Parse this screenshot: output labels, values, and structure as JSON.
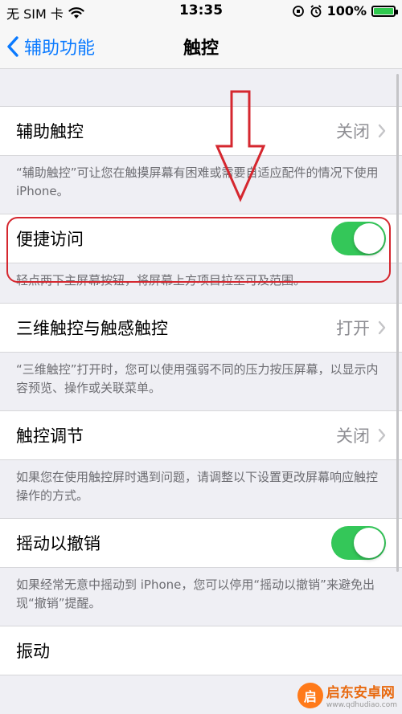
{
  "status_bar": {
    "carrier": "无 SIM 卡",
    "time": "13:35",
    "battery_text": "100%"
  },
  "nav": {
    "back_label": "辅助功能",
    "title": "触控"
  },
  "sections": [
    {
      "label": "辅助触控",
      "value": "关闭",
      "footer": "“辅助触控”可让您在触摸屏幕有困难或需要自适应配件的情况下使用 iPhone。"
    },
    {
      "label": "便捷访问",
      "toggle_on": true,
      "footer": "轻点两下主屏幕按钮，将屏幕上方项目拉至可及范围。"
    },
    {
      "label": "三维触控与触感触控",
      "value": "打开",
      "footer": "“三维触控”打开时，您可以使用强弱不同的压力按压屏幕，以显示内容预览、操作或关联菜单。"
    },
    {
      "label": "触控调节",
      "value": "关闭",
      "footer": "如果您在使用触控屏时遇到问题，请调整以下设置更改屏幕响应触控操作的方式。"
    },
    {
      "label": "摇动以撤销",
      "toggle_on": true,
      "footer": "如果经常无意中摇动到 iPhone，您可以停用“摇动以撤销”来避免出现“撤销”提醒。"
    },
    {
      "label": "振动"
    }
  ],
  "colors": {
    "accent": "#0a7aff",
    "toggle_on": "#34c759",
    "annotation": "#d5272f"
  },
  "watermark": {
    "logo_text": "启",
    "name": "启东安卓网",
    "url": "www.qdhudiao.com"
  }
}
